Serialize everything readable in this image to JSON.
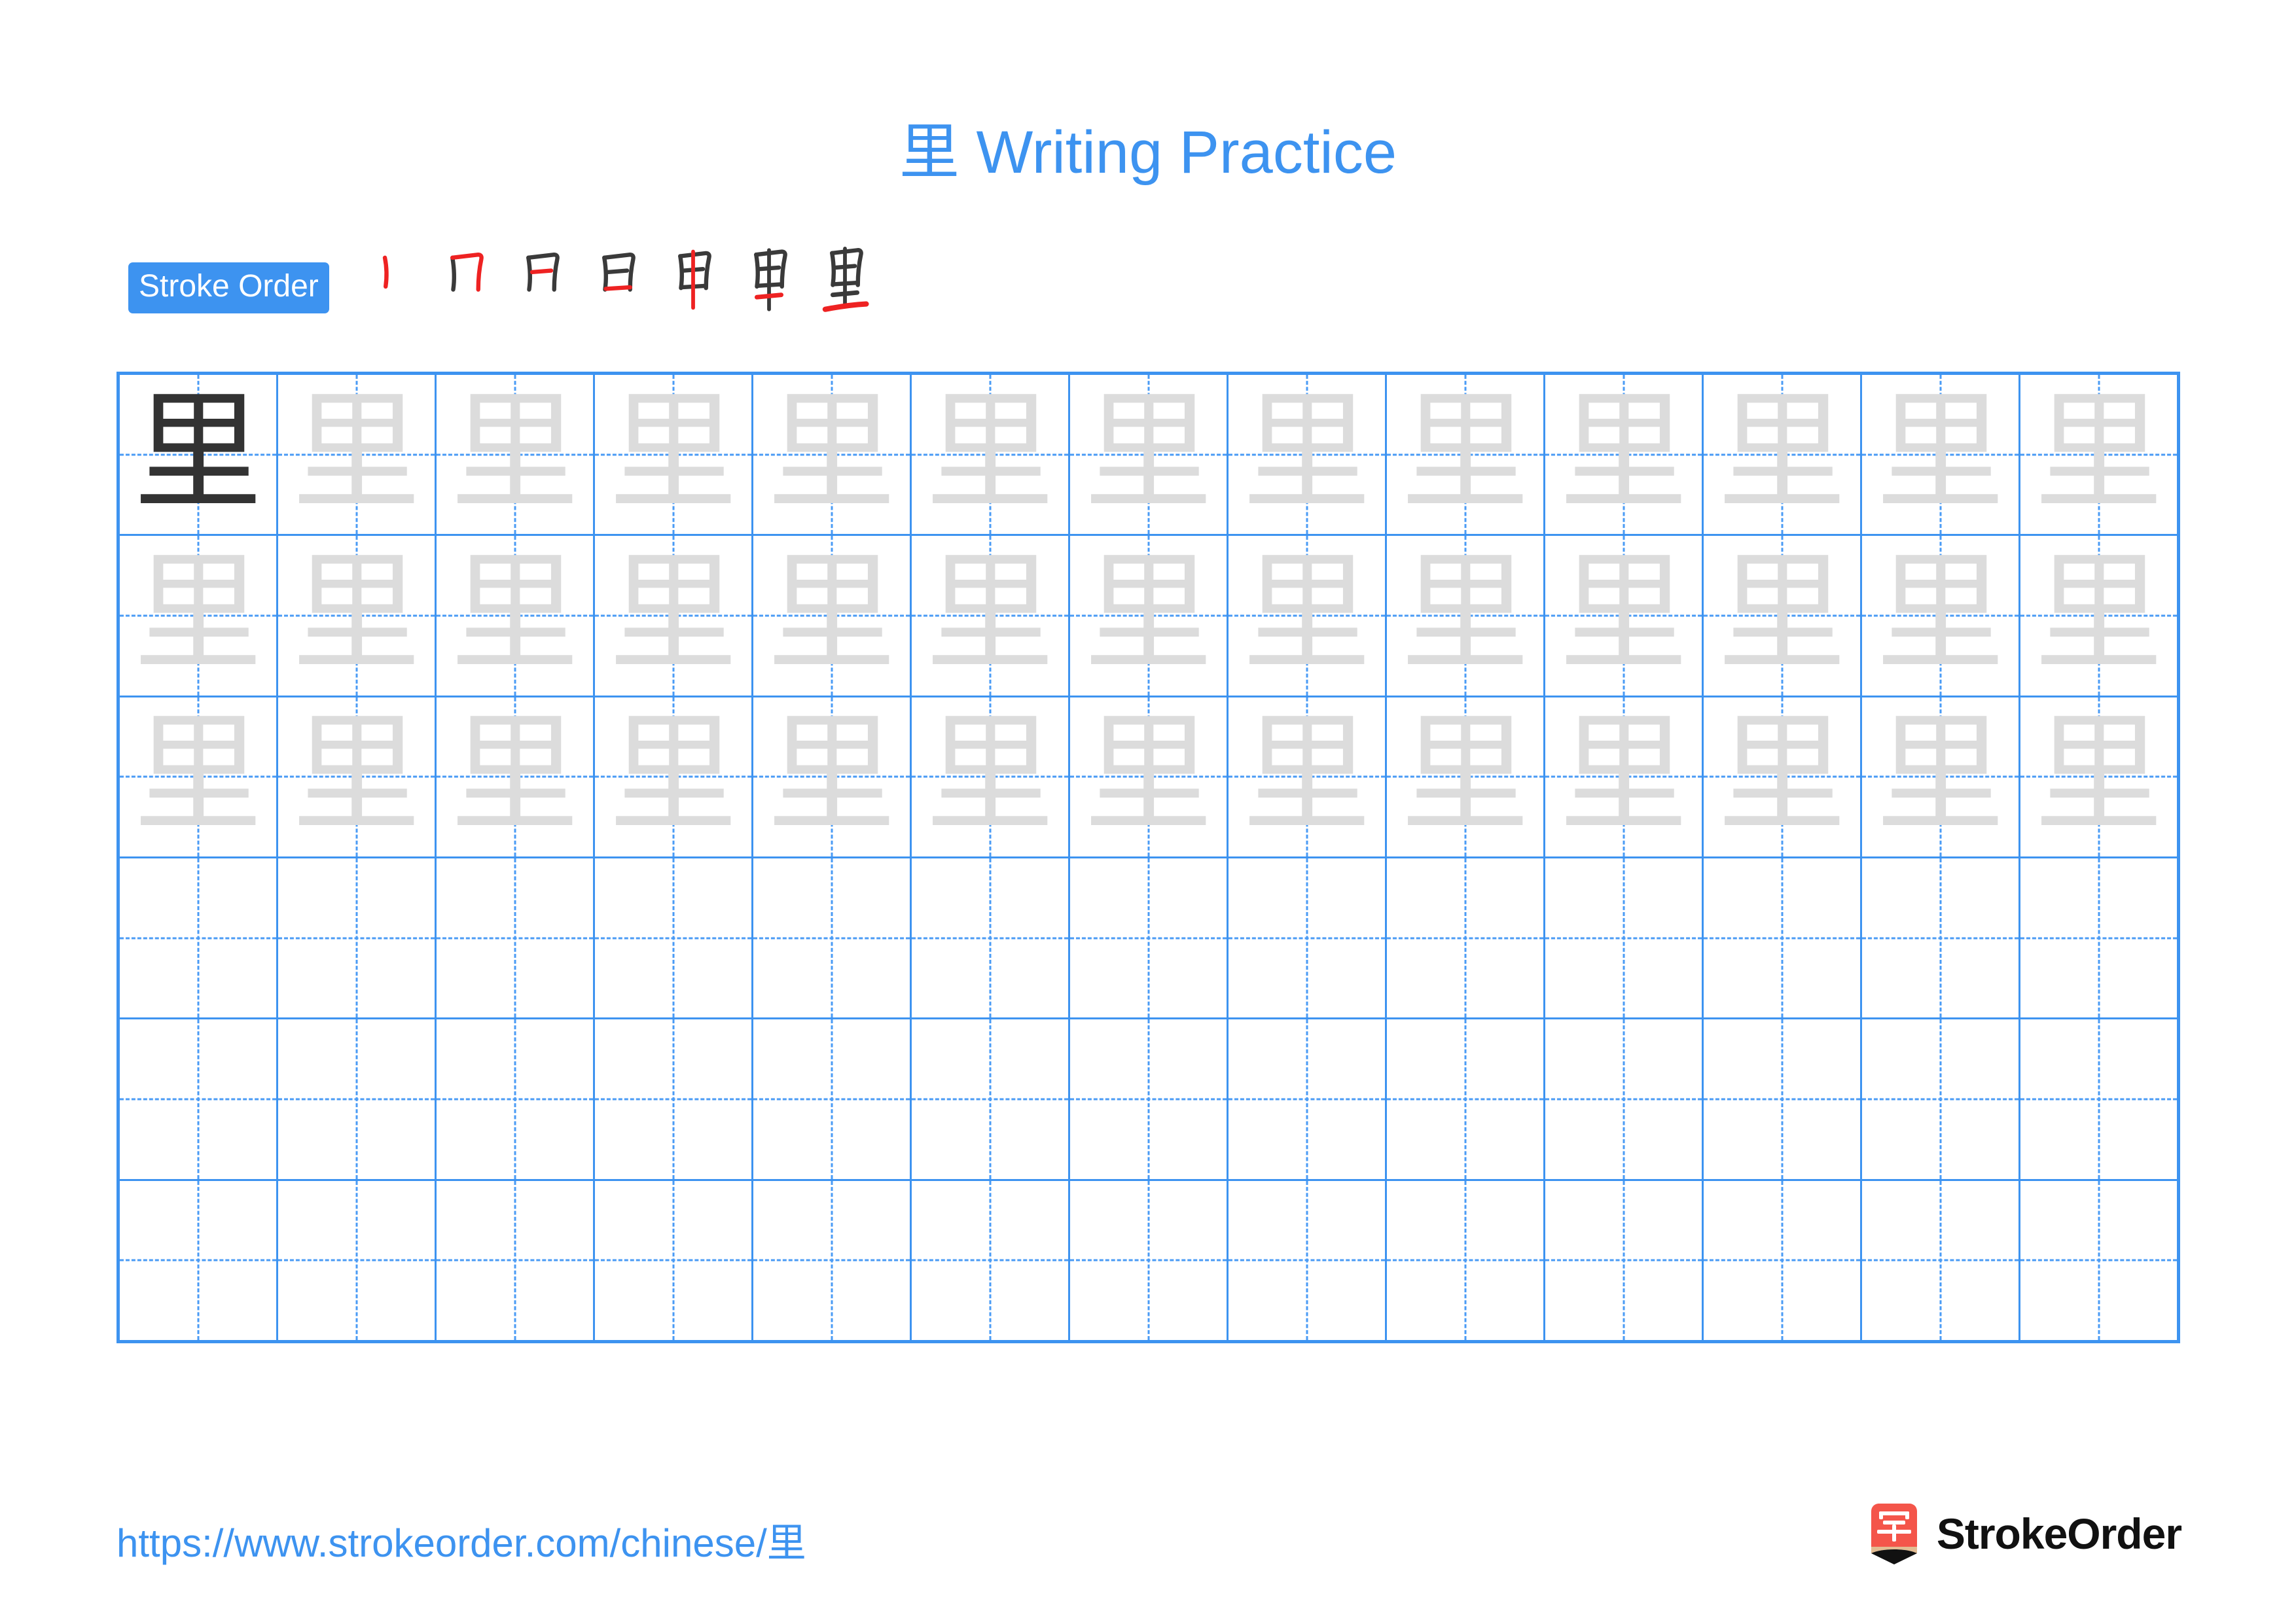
{
  "character": "里",
  "colors": {
    "accent_blue": "#3d93f0",
    "grid_line": "#4a9bf5",
    "model_char": "#333333",
    "trace_char": "#dcdcdc",
    "stroke_new": "#ee2222",
    "stroke_old": "#3a3a3a",
    "logo_red": "#f4554a",
    "logo_wood": "#e2bc92"
  },
  "header": {
    "title_char": "里",
    "title_text": " Writing Practice"
  },
  "stroke_order": {
    "badge_label": "Stroke Order",
    "total_strokes": 7,
    "steps": [
      {
        "index": 1,
        "partial": "丨",
        "new_stroke_name": "shu"
      },
      {
        "index": 2,
        "partial": "冂",
        "new_stroke_name": "heng-zhe"
      },
      {
        "index": 3,
        "partial": "日",
        "new_stroke_name": "heng"
      },
      {
        "index": 4,
        "partial": "日",
        "new_stroke_name": "heng"
      },
      {
        "index": 5,
        "partial": "甲",
        "new_stroke_name": "shu"
      },
      {
        "index": 6,
        "partial": "里",
        "new_stroke_name": "heng"
      },
      {
        "index": 7,
        "partial": "里",
        "new_stroke_name": "heng"
      }
    ]
  },
  "practice_grid": {
    "columns": 13,
    "rows": 6,
    "cells": [
      [
        "dark",
        "trace",
        "trace",
        "trace",
        "trace",
        "trace",
        "trace",
        "trace",
        "trace",
        "trace",
        "trace",
        "trace",
        "trace"
      ],
      [
        "trace",
        "trace",
        "trace",
        "trace",
        "trace",
        "trace",
        "trace",
        "trace",
        "trace",
        "trace",
        "trace",
        "trace",
        "trace"
      ],
      [
        "trace",
        "trace",
        "trace",
        "trace",
        "trace",
        "trace",
        "trace",
        "trace",
        "trace",
        "trace",
        "trace",
        "trace",
        "trace"
      ],
      [
        "blank",
        "blank",
        "blank",
        "blank",
        "blank",
        "blank",
        "blank",
        "blank",
        "blank",
        "blank",
        "blank",
        "blank",
        "blank"
      ],
      [
        "blank",
        "blank",
        "blank",
        "blank",
        "blank",
        "blank",
        "blank",
        "blank",
        "blank",
        "blank",
        "blank",
        "blank",
        "blank"
      ],
      [
        "blank",
        "blank",
        "blank",
        "blank",
        "blank",
        "blank",
        "blank",
        "blank",
        "blank",
        "blank",
        "blank",
        "blank",
        "blank"
      ]
    ]
  },
  "footer": {
    "url": "https://www.strokeorder.com/chinese/里",
    "brand_name": "StrokeOrder",
    "logo_char": "字"
  }
}
